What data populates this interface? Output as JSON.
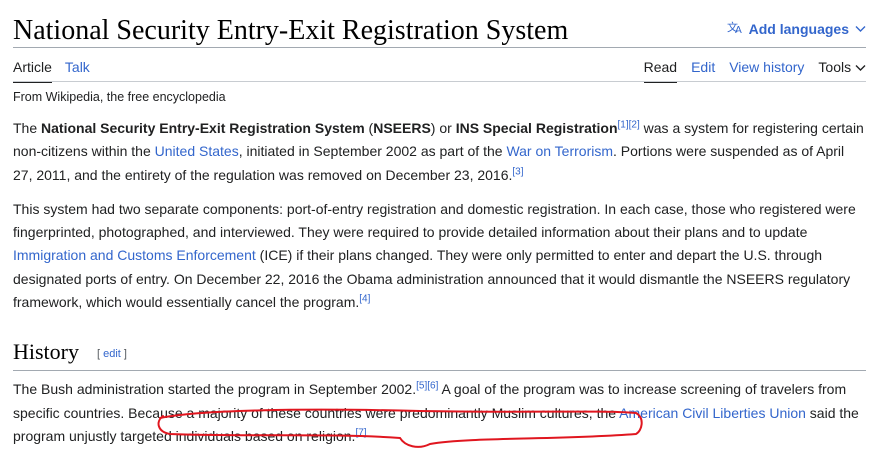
{
  "header": {
    "title": "National Security Entry-Exit Registration System",
    "add_languages": "Add languages"
  },
  "tabs": {
    "article": "Article",
    "talk": "Talk",
    "read": "Read",
    "edit": "Edit",
    "view_history": "View history",
    "tools": "Tools"
  },
  "from_wikipedia": "From Wikipedia, the free encyclopedia",
  "para1": {
    "t1": "The ",
    "b1": "National Security Entry-Exit Registration System",
    "t2": " (",
    "b2": "NSEERS",
    "t3": ") or ",
    "b3": "INS Special Registration",
    "ref1": "[1]",
    "ref2": "[2]",
    "t4": " was a system for registering certain non-citizens within the ",
    "link_us": "United States",
    "t5": ", initiated in September 2002 as part of the ",
    "link_wot": "War on Terrorism",
    "t6": ". Portions were suspended as of April 27, 2011, and the entirety of the regulation was removed on December 23, 2016.",
    "ref3": "[3]"
  },
  "para2": {
    "t1": "This system had two separate components: port-of-entry registration and domestic registration. In each case, those who registered were fingerprinted, photographed, and interviewed. They were required to provide detailed information about their plans and to update ",
    "link_ice": "Immigration and Customs Enforcement",
    "t2": " (ICE) if their plans changed. They were only permitted to enter and depart the U.S. through designated ports of entry. On December 22, 2016 the Obama administration announced that it would dismantle the NSEERS regulatory framework, which would essentially cancel the program.",
    "ref4": "[4]"
  },
  "history": {
    "heading": "History",
    "edit_open": "[ ",
    "edit": "edit",
    "edit_close": " ]"
  },
  "para3": {
    "t1": "The Bush administration started the program in September 2002.",
    "ref5": "[5]",
    "ref6": "[6]",
    "t2": " A goal of the program was to increase screening of travelers from specific countries. Because a majority of these countries were predominantly Muslim cultures, the ",
    "link_aclu": "American Civil Liberties Union",
    "t3": " said the program unjustly targeted individuals based on religion.",
    "ref7": "[7]"
  },
  "colors": {
    "link": "#3366cc",
    "annotation": "#e0161f"
  }
}
